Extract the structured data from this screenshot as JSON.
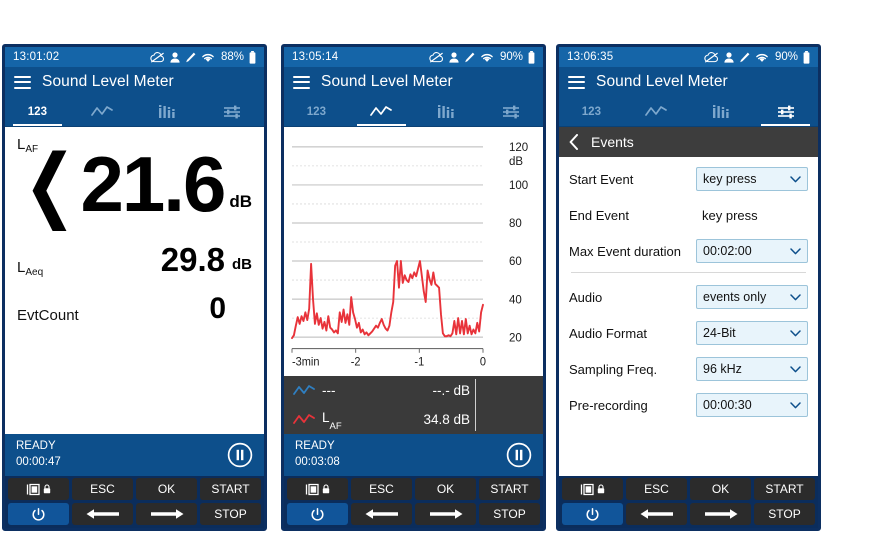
{
  "app": {
    "title": "Sound Level Meter"
  },
  "tabs": [
    {
      "name": "numeric",
      "label": "123"
    },
    {
      "name": "chart",
      "label": ""
    },
    {
      "name": "spectrum",
      "label": ""
    },
    {
      "name": "settings",
      "label": ""
    }
  ],
  "keypad": {
    "lock_label": "",
    "esc_label": "ESC",
    "ok_label": "OK",
    "start_label": "START",
    "power_label": "",
    "left_label": "",
    "right_label": "",
    "stop_label": "STOP"
  },
  "devices": [
    {
      "id": "device-1",
      "statusbar": {
        "clock": "13:01:02",
        "battery": "88%"
      },
      "active_tab": "numeric",
      "readout": {
        "primary_label": "L",
        "primary_sub": "AF",
        "primary_value": "❬21.6",
        "primary_unit": "dB",
        "secondary_label": "L",
        "secondary_sub": "Aeq",
        "secondary_value": "29.8",
        "secondary_unit": "dB",
        "tertiary_label": "EvtCount",
        "tertiary_value": "0"
      },
      "botstatus": {
        "state": "READY",
        "elapsed": "00:00:47"
      }
    },
    {
      "id": "device-2",
      "statusbar": {
        "clock": "13:05:14",
        "battery": "90%"
      },
      "active_tab": "chart",
      "botstatus": {
        "state": "READY",
        "elapsed": "00:03:08"
      },
      "legend": [
        {
          "color": "#2f7fc1",
          "name": "---",
          "sub": "",
          "value": "--.- dB"
        },
        {
          "color": "#e8333a",
          "name": "L",
          "sub": "AF",
          "value": "34.8 dB"
        }
      ]
    },
    {
      "id": "device-3",
      "statusbar": {
        "clock": "13:06:35",
        "battery": "90%"
      },
      "active_tab": "settings",
      "subheader": {
        "title": "Events"
      },
      "settings": [
        {
          "label": "Start Event",
          "value": "key press",
          "control": "dropdown"
        },
        {
          "label": "End Event",
          "value": "key press",
          "control": "static"
        },
        {
          "label": "Max Event duration",
          "value": "00:02:00",
          "control": "dropdown"
        },
        {
          "label": "Audio",
          "value": "events only",
          "control": "dropdown"
        },
        {
          "label": "Audio Format",
          "value": "24-Bit",
          "control": "dropdown"
        },
        {
          "label": "Sampling Freq.",
          "value": "96 kHz",
          "control": "dropdown"
        },
        {
          "label": "Pre-recording",
          "value": "00:00:30",
          "control": "dropdown"
        }
      ]
    }
  ],
  "chart_data": {
    "type": "line",
    "title": "",
    "xlabel": "",
    "ylabel": "dB",
    "unit_label": "dB",
    "xlim": [
      -3,
      0
    ],
    "ylim": [
      14,
      126
    ],
    "yticks": [
      20,
      40,
      60,
      80,
      100,
      120
    ],
    "yticklabels": [
      "20",
      "40",
      "60",
      "80",
      "100",
      "120"
    ],
    "minor_yticks": [
      30,
      50,
      70,
      90,
      110
    ],
    "xticks": [
      -3,
      -2,
      -1,
      0
    ],
    "xticklabels": [
      "-3min",
      "-2",
      "-1",
      "0"
    ],
    "grid": true,
    "legend_position": "below",
    "series": [
      {
        "name": "LAF",
        "color": "#e8333a",
        "x": [
          -3.0,
          -2.97,
          -2.94,
          -2.91,
          -2.88,
          -2.85,
          -2.82,
          -2.79,
          -2.76,
          -2.73,
          -2.7,
          -2.67,
          -2.64,
          -2.61,
          -2.58,
          -2.55,
          -2.52,
          -2.49,
          -2.46,
          -2.43,
          -2.4,
          -2.37,
          -2.34,
          -2.31,
          -2.28,
          -2.25,
          -2.22,
          -2.19,
          -2.16,
          -2.13,
          -2.1,
          -2.07,
          -2.04,
          -2.01,
          -1.98,
          -1.95,
          -1.92,
          -1.89,
          -1.86,
          -1.83,
          -1.8,
          -1.77,
          -1.74,
          -1.71,
          -1.68,
          -1.65,
          -1.62,
          -1.59,
          -1.56,
          -1.53,
          -1.5,
          -1.47,
          -1.44,
          -1.41,
          -1.38,
          -1.35,
          -1.32,
          -1.29,
          -1.26,
          -1.23,
          -1.2,
          -1.17,
          -1.14,
          -1.11,
          -1.08,
          -1.05,
          -1.02,
          -0.99,
          -0.96,
          -0.93,
          -0.9,
          -0.87,
          -0.84,
          -0.81,
          -0.78,
          -0.75,
          -0.72,
          -0.69,
          -0.66,
          -0.63,
          -0.6,
          -0.57,
          -0.54,
          -0.51,
          -0.48,
          -0.45,
          -0.42,
          -0.39,
          -0.36,
          -0.33,
          -0.3,
          -0.27,
          -0.24,
          -0.21,
          -0.18,
          -0.15,
          -0.12,
          -0.09,
          -0.06,
          -0.03,
          0.0
        ],
        "y": [
          19.5,
          21.0,
          26.0,
          30.5,
          27.0,
          31.0,
          28.5,
          33.0,
          29.0,
          35.0,
          58.5,
          40.0,
          27.0,
          32.5,
          26.5,
          30.0,
          24.5,
          28.0,
          23.5,
          31.0,
          25.0,
          24.0,
          22.5,
          23.5,
          22.0,
          33.0,
          28.0,
          34.5,
          27.5,
          32.0,
          26.5,
          41.0,
          33.0,
          29.5,
          25.0,
          27.5,
          22.5,
          24.0,
          21.5,
          22.5,
          21.0,
          22.0,
          23.0,
          24.5,
          26.0,
          25.0,
          27.5,
          29.5,
          26.5,
          24.5,
          23.5,
          26.0,
          33.0,
          38.5,
          57.5,
          60.0,
          46.0,
          60.0,
          48.5,
          52.5,
          50.0,
          49.0,
          53.0,
          51.0,
          54.0,
          52.0,
          56.0,
          60.0,
          52.0,
          44.0,
          38.5,
          55.0,
          50.5,
          47.5,
          54.0,
          48.0,
          47.0,
          46.0,
          32.0,
          22.0,
          20.5,
          20.5,
          21.0,
          20.5,
          22.0,
          28.5,
          21.5,
          30.0,
          22.0,
          28.5,
          21.5,
          29.5,
          22.0,
          26.0,
          21.5,
          24.0,
          22.0,
          27.5,
          23.0,
          33.0,
          37.0
        ]
      }
    ]
  }
}
